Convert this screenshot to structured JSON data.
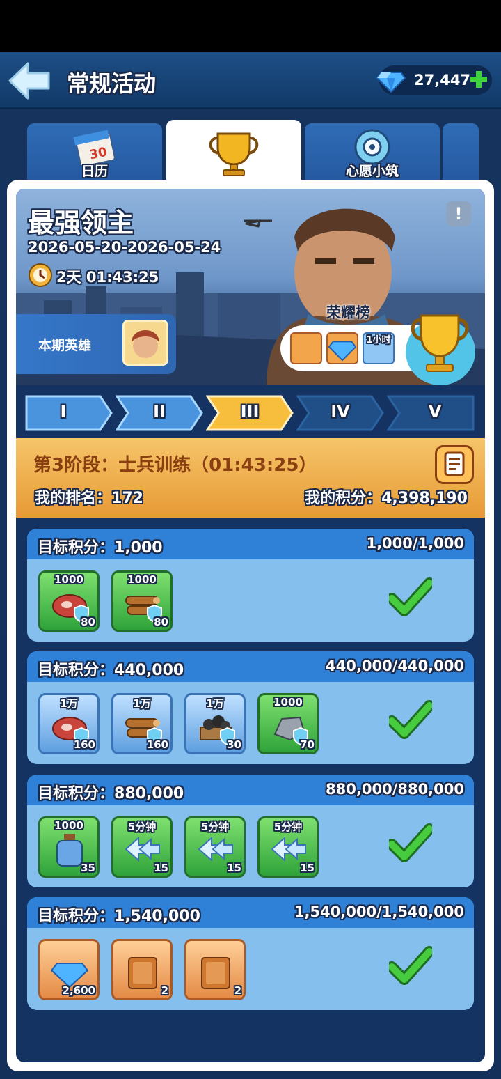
{
  "header": {
    "title": "常规活动",
    "gems": "27,447"
  },
  "tabs": [
    {
      "label": "日历",
      "icon": "calendar-icon",
      "calendar_day": "30"
    },
    {
      "label": "",
      "icon": "trophy-icon"
    },
    {
      "label": "心愿小筑",
      "icon": "wish-house-icon"
    }
  ],
  "banner": {
    "title": "最强领主",
    "dates": "2026-05-20-2026-05-24",
    "countdown": "2天 01:43:25",
    "hero_label": "本期英雄",
    "honor_label": "荣耀榜",
    "honor_rewards": [
      "hero-puzzle-icon",
      "gem-icon",
      "speedup-icon"
    ],
    "honor_speedup_text": "1小时"
  },
  "stages": [
    "I",
    "II",
    "III",
    "IV",
    "V"
  ],
  "active_stage": 2,
  "stage_info": {
    "title": "第3阶段：士兵训练（01:43:25）",
    "rank_label": "我的排名：",
    "rank": "172",
    "score_label": "我的积分：",
    "score": "4,398,190"
  },
  "colors": {
    "accent_gold": "#f6c56a",
    "card_blue": "#85bfee",
    "header_blue": "#2f80d7",
    "check_green": "#3fc33f"
  },
  "tiers": [
    {
      "target_label": "目标积分：",
      "target": "1,000",
      "progress": "1,000/1,000",
      "complete": true,
      "items": [
        {
          "style": "green",
          "top": "1000",
          "count": "80",
          "icon": "meat-icon",
          "shield": true
        },
        {
          "style": "green",
          "top": "1000",
          "count": "80",
          "icon": "wood-icon",
          "shield": true
        }
      ]
    },
    {
      "target_label": "目标积分：",
      "target": "440,000",
      "progress": "440,000/440,000",
      "complete": true,
      "items": [
        {
          "style": "blue",
          "top": "1万",
          "count": "160",
          "icon": "meat-icon",
          "shield": true
        },
        {
          "style": "blue",
          "top": "1万",
          "count": "160",
          "icon": "wood-icon",
          "shield": true
        },
        {
          "style": "blue",
          "top": "1万",
          "count": "30",
          "icon": "coal-icon",
          "shield": true
        },
        {
          "style": "green",
          "top": "1000",
          "count": "70",
          "icon": "iron-icon",
          "shield": true
        }
      ]
    },
    {
      "target_label": "目标积分：",
      "target": "880,000",
      "progress": "880,000/880,000",
      "complete": true,
      "items": [
        {
          "style": "green",
          "top": "1000",
          "count": "35",
          "icon": "exp-bottle-icon",
          "shield": false
        },
        {
          "style": "green",
          "top": "5分钟",
          "count": "15",
          "icon": "speedup-hammer-icon",
          "shield": false
        },
        {
          "style": "green",
          "top": "5分钟",
          "count": "15",
          "icon": "speedup-research-icon",
          "shield": false
        },
        {
          "style": "green",
          "top": "5分钟",
          "count": "15",
          "icon": "speedup-soldier-icon",
          "shield": false
        }
      ]
    },
    {
      "target_label": "目标积分：",
      "target": "1,540,000",
      "progress": "1,540,000/1,540,000",
      "complete": true,
      "items": [
        {
          "style": "orange",
          "top": "",
          "count": "2,600",
          "icon": "gem-icon",
          "shield": false
        },
        {
          "style": "orange",
          "top": "",
          "count": "2",
          "icon": "flag-book-icon",
          "shield": false
        },
        {
          "style": "orange",
          "top": "",
          "count": "2",
          "icon": "sword-book-icon",
          "shield": false
        }
      ]
    }
  ]
}
